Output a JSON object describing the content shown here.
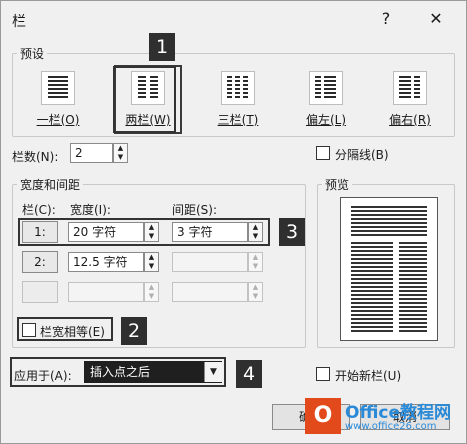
{
  "dialog": {
    "title": "栏",
    "help": "?",
    "close": "✕"
  },
  "presets": {
    "legend": "预设",
    "items": [
      {
        "label": "一栏(O)",
        "selected": false
      },
      {
        "label": "两栏(W)",
        "selected": true
      },
      {
        "label": "三栏(T)",
        "selected": false
      },
      {
        "label": "偏左(L)",
        "selected": false
      },
      {
        "label": "偏右(R)",
        "selected": false
      }
    ]
  },
  "num_columns": {
    "label": "栏数(N):",
    "value": "2"
  },
  "separator": {
    "label": "分隔线(B)",
    "checked": false
  },
  "width_spacing": {
    "legend": "宽度和间距",
    "col_header": "栏(C):",
    "width_header": "宽度(I):",
    "spacing_header": "间距(S):",
    "rows": [
      {
        "col": "1:",
        "width": "20 字符",
        "spacing": "3 字符"
      },
      {
        "col": "2:",
        "width": "12.5 字符",
        "spacing": ""
      },
      {
        "col": "",
        "width": "",
        "spacing": ""
      }
    ]
  },
  "equal_width": {
    "label": "栏宽相等(E)",
    "checked": false
  },
  "preview": {
    "legend": "预览"
  },
  "apply_to": {
    "label": "应用于(A):",
    "value": "插入点之后"
  },
  "start_new_column": {
    "label": "开始新栏(U)",
    "checked": false
  },
  "buttons": {
    "ok": "确定",
    "cancel": "取消"
  },
  "badges": {
    "b1": "1",
    "b2": "2",
    "b3": "3",
    "b4": "4"
  },
  "watermark": {
    "logo": "O",
    "text": "Office教程网",
    "url": "www.office26.com"
  },
  "colors": {
    "badge": "#2f2f2f",
    "apply_field": "#1f1f1f",
    "watermark_orange": "#e24a1c",
    "watermark_blue": "#2a8ad8"
  }
}
